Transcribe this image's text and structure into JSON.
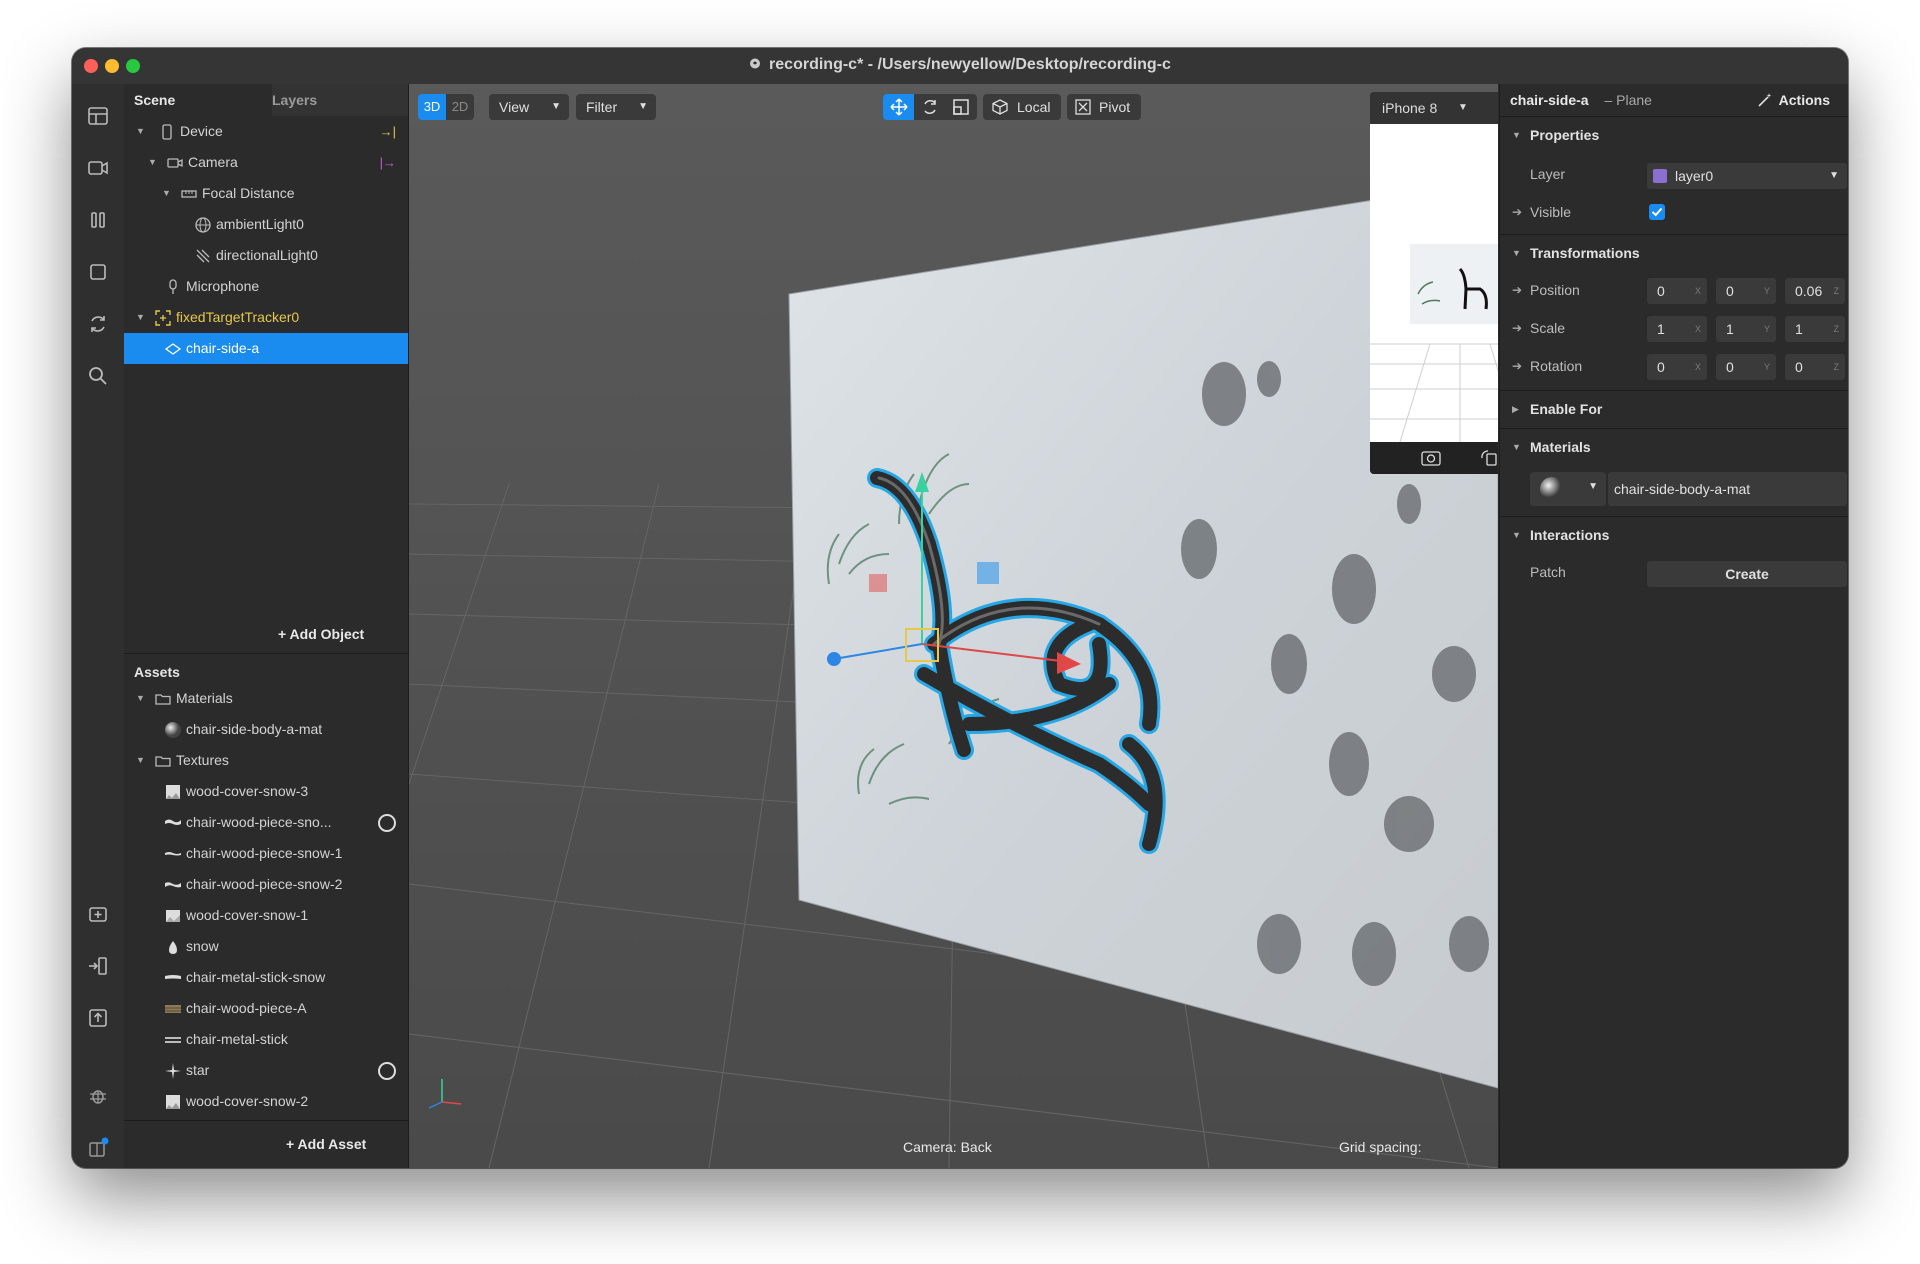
{
  "window": {
    "title": "recording-c* - /Users/newyellow/Desktop/recording-c"
  },
  "sidebar_icons": [
    "layout-icon",
    "video-icon",
    "columns-icon",
    "square-icon",
    "refresh-icon",
    "search-icon",
    "add-folder-icon",
    "import-icon",
    "export-icon",
    "bug-icon",
    "extensions-icon"
  ],
  "scene": {
    "tabs": {
      "scene": "Scene",
      "layers": "Layers"
    },
    "tree": [
      {
        "label": "Device",
        "icon": "phone-icon"
      },
      {
        "label": "Camera",
        "icon": "camera-icon"
      },
      {
        "label": "Focal Distance",
        "icon": "ruler-icon"
      },
      {
        "label": "ambientLight0",
        "icon": "globe-light-icon"
      },
      {
        "label": "directionalLight0",
        "icon": "directional-light-icon"
      },
      {
        "label": "Microphone",
        "icon": "microphone-icon"
      },
      {
        "label": "fixedTargetTracker0",
        "icon": "tracker-icon"
      },
      {
        "label": "chair-side-a",
        "icon": "plane-icon"
      }
    ],
    "add_object": "Add Object"
  },
  "assets": {
    "title": "Assets",
    "items": [
      {
        "label": "Materials",
        "icon": "folder-icon"
      },
      {
        "label": "chair-side-body-a-mat",
        "icon": "material-sphere-icon"
      },
      {
        "label": "Textures",
        "icon": "folder-icon"
      },
      {
        "label": "wood-cover-snow-3",
        "icon": "texture-icon"
      },
      {
        "label": "chair-wood-piece-sno...",
        "icon": "texture-icon"
      },
      {
        "label": "chair-wood-piece-snow-1",
        "icon": "texture-icon"
      },
      {
        "label": "chair-wood-piece-snow-2",
        "icon": "texture-icon"
      },
      {
        "label": "wood-cover-snow-1",
        "icon": "texture-icon"
      },
      {
        "label": "snow",
        "icon": "texture-icon"
      },
      {
        "label": "chair-metal-stick-snow",
        "icon": "texture-icon"
      },
      {
        "label": "chair-wood-piece-A",
        "icon": "texture-icon"
      },
      {
        "label": "chair-metal-stick",
        "icon": "texture-icon"
      },
      {
        "label": "star",
        "icon": "texture-icon"
      },
      {
        "label": "wood-cover-snow-2",
        "icon": "texture-icon"
      }
    ],
    "add_asset": "Add Asset"
  },
  "viewport": {
    "mode_3d": "3D",
    "mode_2d": "2D",
    "view_label": "View",
    "filter_label": "Filter",
    "local_label": "Local",
    "pivot_label": "Pivot",
    "device_label": "iPhone 8",
    "camera_status": "Camera: Back",
    "grid_spacing": "Grid spacing:"
  },
  "inspector": {
    "object_name": "chair-side-a",
    "object_type": "– Plane",
    "actions_label": "Actions",
    "properties": {
      "title": "Properties",
      "layer_label": "Layer",
      "layer_value": "layer0",
      "visible_label": "Visible"
    },
    "transformations": {
      "title": "Transformations",
      "position_label": "Position",
      "position": [
        "0",
        "0",
        "0.06"
      ],
      "scale_label": "Scale",
      "scale": [
        "1",
        "1",
        "1"
      ],
      "rotation_label": "Rotation",
      "rotation": [
        "0",
        "0",
        "0"
      ],
      "axes": [
        "X",
        "Y",
        "Z"
      ]
    },
    "enable_for": "Enable For",
    "materials": {
      "title": "Materials",
      "value": "chair-side-body-a-mat"
    },
    "interactions": {
      "title": "Interactions",
      "patch_label": "Patch",
      "create_label": "Create"
    }
  },
  "colors": {
    "accent": "#1a8cf0",
    "tracker": "#e6c84a",
    "layer_swatch": "#8a6fd1"
  }
}
